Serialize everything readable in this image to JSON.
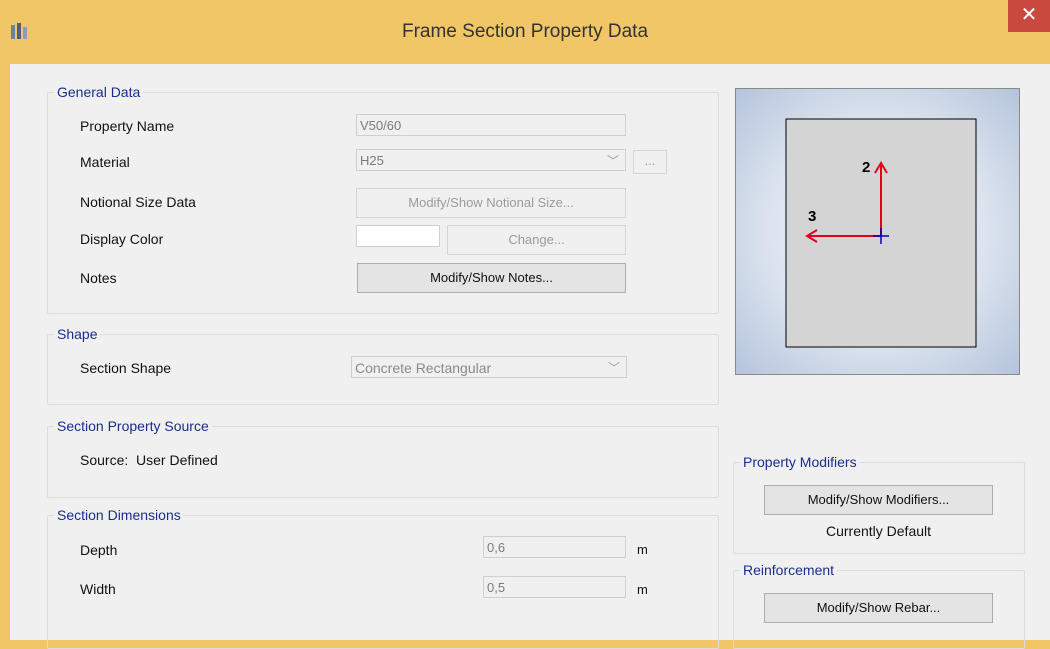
{
  "window": {
    "title": "Frame Section Property Data",
    "close_glyph": "✕",
    "app_icon": "etabs-app-icon"
  },
  "general_data": {
    "legend": "General Data",
    "property_name_label": "Property Name",
    "property_name_value": "V50/60",
    "material_label": "Material",
    "material_value": "H25",
    "material_more": "...",
    "notional_label": "Notional Size Data",
    "notional_button": "Modify/Show Notional Size...",
    "display_color_label": "Display Color",
    "display_color_value": "#ffffff",
    "change_button": "Change...",
    "notes_label": "Notes",
    "notes_button": "Modify/Show Notes..."
  },
  "shape": {
    "legend": "Shape",
    "section_shape_label": "Section Shape",
    "section_shape_value": "Concrete Rectangular"
  },
  "source": {
    "legend": "Section Property Source",
    "text": "Source:  User Defined"
  },
  "dimensions": {
    "legend": "Section Dimensions",
    "depth_label": "Depth",
    "depth_value": "0,6",
    "depth_unit": "m",
    "width_label": "Width",
    "width_value": "0,5",
    "width_unit": "m"
  },
  "preview": {
    "axis_2_label": "2",
    "axis_3_label": "3",
    "section_fill": "#d4d4d4",
    "axis_color": "#e3001b",
    "origin_color": "#0000cc"
  },
  "property_modifiers": {
    "legend": "Property Modifiers",
    "button": "Modify/Show Modifiers...",
    "status": "Currently Default"
  },
  "reinforcement": {
    "legend": "Reinforcement",
    "button": "Modify/Show Rebar..."
  }
}
